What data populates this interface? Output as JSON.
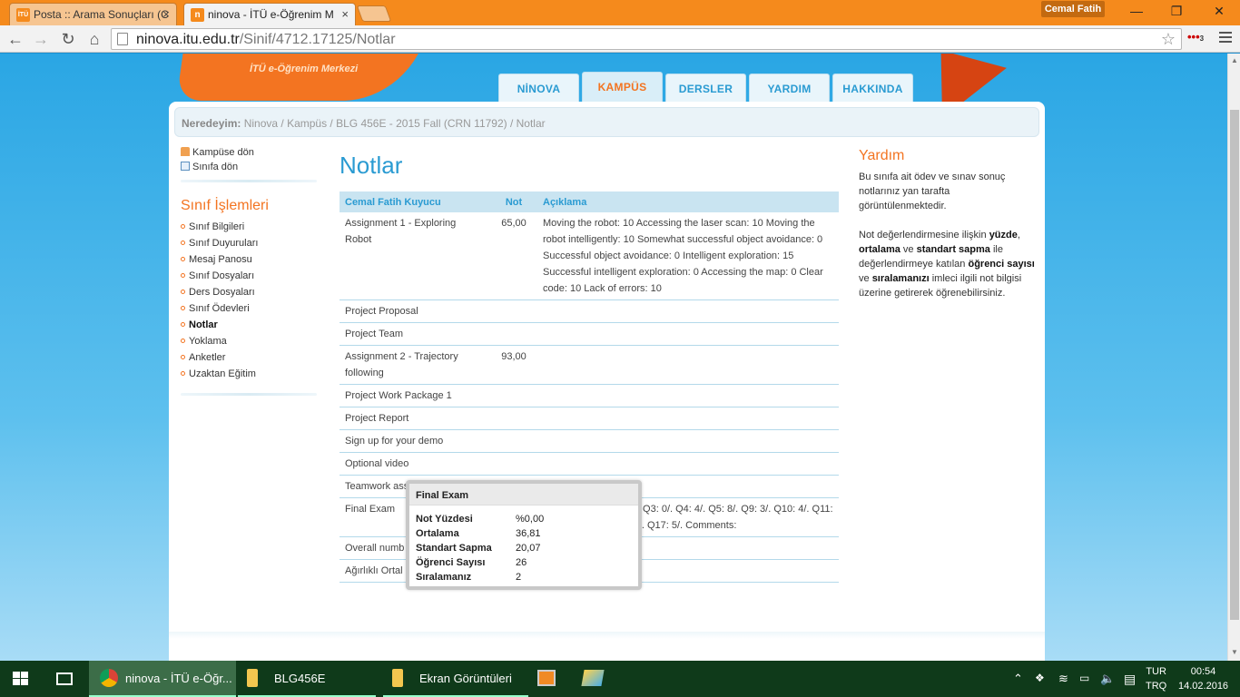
{
  "browser": {
    "tabs": [
      {
        "title": "Posta :: Arama Sonuçları (C",
        "favicon": "İTÜ",
        "close": "×"
      },
      {
        "title": "ninova - İTÜ e-Öğrenim M",
        "favicon": "n",
        "close": "×"
      }
    ],
    "user": "Cemal Fatih",
    "window_controls": {
      "minimize": "—",
      "restore": "❐",
      "close": "✕"
    },
    "url_host": "ninova.itu.edu.tr",
    "url_path": "/Sinif/4712.17125/Notlar",
    "extension_badge": "3"
  },
  "site": {
    "logo_subtitle": "İTÜ e-Öğrenim Merkezi",
    "nav": [
      "NİNOVA",
      "KAMPÜS",
      "DERSLER",
      "YARDIM",
      "HAKKINDA"
    ],
    "active_nav": "KAMPÜS",
    "breadcrumb_label": "Neredeyim:",
    "breadcrumb": "Ninova / Kampüs / BLG 456E - 2015 Fall (CRN 11792) / Notlar"
  },
  "sidebar": {
    "quick_links": [
      "Kampüse dön",
      "Sınıfa dön"
    ],
    "section_title": "Sınıf İşlemleri",
    "items": [
      "Sınıf Bilgileri",
      "Sınıf Duyuruları",
      "Mesaj Panosu",
      "Sınıf Dosyaları",
      "Ders Dosyaları",
      "Sınıf Ödevleri",
      "Notlar",
      "Yoklama",
      "Anketler",
      "Uzaktan Eğitim"
    ],
    "active_item": "Notlar"
  },
  "main": {
    "title": "Notlar",
    "columns": [
      "Cemal Fatih Kuyucu",
      "Not",
      "Açıklama"
    ],
    "rows": [
      {
        "name": "Assignment 1 - Exploring Robot",
        "grade": "65,00",
        "desc": "Moving the robot: 10 Accessing the laser scan: 10 Moving the robot intelligently: 10 Somewhat successful object avoidance: 0 Successful object avoidance: 0 Intelligent exploration: 15 Successful intelligent exploration: 0 Accessing the map: 0 Clear code: 10 Lack of errors: 10"
      },
      {
        "name": "Project Proposal",
        "grade": "",
        "desc": ""
      },
      {
        "name": "Project Team",
        "grade": "",
        "desc": ""
      },
      {
        "name": "Assignment 2 - Trajectory following",
        "grade": "93,00",
        "desc": ""
      },
      {
        "name": "Project Work Package 1",
        "grade": "",
        "desc": ""
      },
      {
        "name": "Project Report",
        "grade": "",
        "desc": ""
      },
      {
        "name": "Sign up for your demo",
        "grade": "",
        "desc": ""
      },
      {
        "name": "Optional video",
        "grade": "",
        "desc": ""
      },
      {
        "name": "Teamwork assessment - final",
        "grade": "",
        "desc": ""
      },
      {
        "name": "Final Exam",
        "grade": "",
        "desc": "kdown: Q1: 1/. Q2: 2/. Q3: 0/. Q4: 4/. Q5: 8/. Q9: 3/. Q10: 4/. Q11: 2/. Q12: 0/. Q13: 7/. 4/. Q17: 5/. Comments:"
      },
      {
        "name": "Overall numb course",
        "grade": "",
        "desc": ""
      },
      {
        "name": "Ağırlıklı Ortal",
        "grade": "",
        "desc": ""
      }
    ]
  },
  "help": {
    "title": "Yardım",
    "p1": "Bu sınıfa ait ödev ve sınav sonuç notlarınız yan tarafta görüntülenmektedir.",
    "p2_parts": [
      "Not değerlendirmesine ilişkin ",
      "yüzde",
      ", ",
      "ortalama",
      " ve ",
      "standart sapma",
      " ile değerlendirmeye katılan ",
      "öğrenci sayısı",
      " ve ",
      "sıralamanızı",
      " imleci ilgili not bilgisi üzerine getirerek öğrenebilirsiniz."
    ]
  },
  "popup": {
    "title": "Final Exam",
    "rows": [
      {
        "k": "Not Yüzdesi",
        "v": "%0,00"
      },
      {
        "k": "Ortalama",
        "v": "36,81"
      },
      {
        "k": "Standart Sapma",
        "v": "20,07"
      },
      {
        "k": "Öğrenci Sayısı",
        "v": "26"
      },
      {
        "k": "Sıralamanız",
        "v": "2"
      }
    ]
  },
  "taskbar": {
    "buttons": [
      "ninova - İTÜ e-Öğr...",
      "BLG456E",
      "Ekran Görüntüleri"
    ],
    "lang": [
      "TUR",
      "TRQ"
    ],
    "time": "00:54",
    "date": "14.02.2016"
  }
}
